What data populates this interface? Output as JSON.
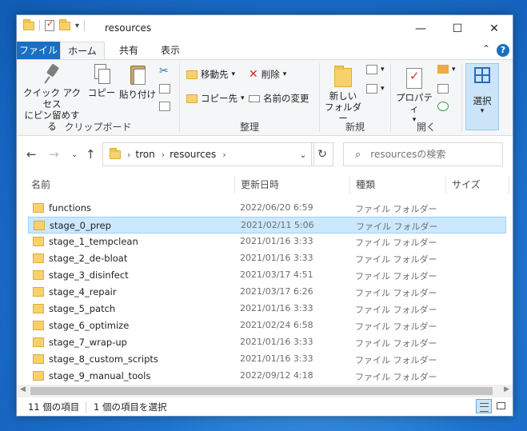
{
  "window": {
    "title": "resources",
    "minimize": "—",
    "maximize": "☐",
    "close": "✕"
  },
  "tabs": {
    "file": "ファイル",
    "home": "ホーム",
    "share": "共有",
    "view": "表示"
  },
  "ribbon": {
    "clipboard": {
      "group_label": "クリップボード",
      "pin_line1": "クイック アクセス",
      "pin_line2": "にピン留めする",
      "copy": "コピー",
      "paste": "貼り付け"
    },
    "organize": {
      "group_label": "整理",
      "move_to": "移動先",
      "copy_to": "コピー先",
      "delete": "削除",
      "rename": "名前の変更"
    },
    "new": {
      "group_label": "新規",
      "new_folder_line1": "新しい",
      "new_folder_line2": "フォルダー"
    },
    "open": {
      "group_label": "開く",
      "properties": "プロパティ"
    },
    "select": {
      "label": "選択"
    }
  },
  "address": {
    "crumbs": [
      "tron",
      "resources"
    ],
    "search_placeholder": "resourcesの検索"
  },
  "columns": {
    "name": "名前",
    "modified": "更新日時",
    "type": "種類",
    "size": "サイズ"
  },
  "files": [
    {
      "name": "functions",
      "modified": "2022/06/20 6:59",
      "type": "ファイル フォルダー"
    },
    {
      "name": "stage_0_prep",
      "modified": "2021/02/11 5:06",
      "type": "ファイル フォルダー"
    },
    {
      "name": "stage_1_tempclean",
      "modified": "2021/01/16 3:33",
      "type": "ファイル フォルダー"
    },
    {
      "name": "stage_2_de-bloat",
      "modified": "2021/01/16 3:33",
      "type": "ファイル フォルダー"
    },
    {
      "name": "stage_3_disinfect",
      "modified": "2021/03/17 4:51",
      "type": "ファイル フォルダー"
    },
    {
      "name": "stage_4_repair",
      "modified": "2021/03/17 6:26",
      "type": "ファイル フォルダー"
    },
    {
      "name": "stage_5_patch",
      "modified": "2021/01/16 3:33",
      "type": "ファイル フォルダー"
    },
    {
      "name": "stage_6_optimize",
      "modified": "2021/02/24 6:58",
      "type": "ファイル フォルダー"
    },
    {
      "name": "stage_7_wrap-up",
      "modified": "2021/01/16 3:33",
      "type": "ファイル フォルダー"
    },
    {
      "name": "stage_8_custom_scripts",
      "modified": "2021/01/16 3:33",
      "type": "ファイル フォルダー"
    },
    {
      "name": "stage_9_manual_tools",
      "modified": "2022/09/12 4:18",
      "type": "ファイル フォルダー"
    }
  ],
  "selected_file": "stage_0_prep",
  "status": {
    "item_count": "11 個の項目",
    "selected_count": "1 個の項目を選択"
  },
  "colors": {
    "accent": "#1a6fc2",
    "selection": "#cce8ff"
  }
}
